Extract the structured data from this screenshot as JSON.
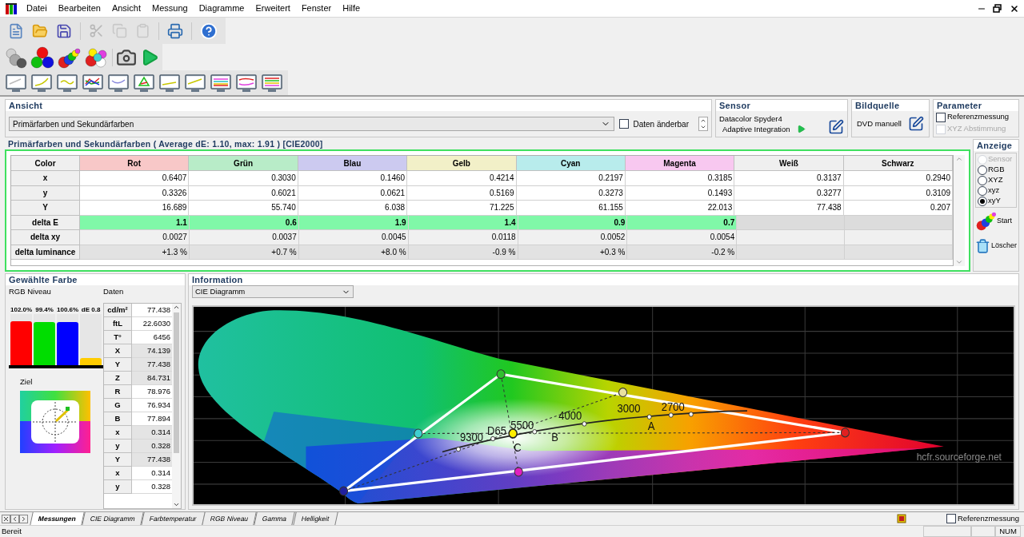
{
  "menu": [
    "Datei",
    "Bearbeiten",
    "Ansicht",
    "Messung",
    "Diagramme",
    "Erweitert",
    "Fenster",
    "Hilfe"
  ],
  "ansicht": {
    "title": "Ansicht",
    "select_value": "Primärfarben und Sekundärfarben",
    "editable": {
      "label": "Daten änderbar",
      "checked": false
    }
  },
  "sensor": {
    "title": "Sensor",
    "device": "Datacolor Spyder4",
    "mode": "Adaptive Integration"
  },
  "bildquelle": {
    "title": "Bildquelle",
    "value": "DVD manuell"
  },
  "parameter": {
    "title": "Parameter",
    "options": [
      {
        "label": "Referenzmessung",
        "checked": false,
        "disabled": false
      },
      {
        "label": "XYZ Abstimmung",
        "checked": false,
        "disabled": true
      }
    ]
  },
  "table": {
    "title": "Primärfarben und Sekundärfarben ( Average dE: 1.10, max: 1.91 ) [CIE2000]",
    "columns": [
      {
        "label": "Color"
      },
      {
        "label": "Rot",
        "color": "#f8c8c8"
      },
      {
        "label": "Grün",
        "color": "#b8ecc8"
      },
      {
        "label": "Blau",
        "color": "#cccaf0"
      },
      {
        "label": "Gelb",
        "color": "#f2f0c8"
      },
      {
        "label": "Cyan",
        "color": "#b8ecec"
      },
      {
        "label": "Magenta",
        "color": "#f8c8f0"
      },
      {
        "label": "Weiß",
        "color": "#efefef"
      },
      {
        "label": "Schwarz",
        "color": "#efefef"
      }
    ],
    "rows": [
      {
        "label": "x",
        "kind": "plain",
        "cells": [
          "0.6407",
          "0.3030",
          "0.1460",
          "0.4214",
          "0.2197",
          "0.3185",
          "0.3137",
          "0.2940"
        ]
      },
      {
        "label": "y",
        "kind": "plain",
        "cells": [
          "0.3326",
          "0.6021",
          "0.0621",
          "0.5169",
          "0.3273",
          "0.1493",
          "0.3277",
          "0.3109"
        ]
      },
      {
        "label": "Y",
        "kind": "plain",
        "cells": [
          "16.689",
          "55.740",
          "6.038",
          "71.225",
          "61.155",
          "22.013",
          "77.438",
          "0.207"
        ]
      },
      {
        "label": "delta E",
        "kind": "rating",
        "cells": [
          "1.1",
          "0.6",
          "1.9",
          "1.4",
          "0.9",
          "0.7"
        ]
      },
      {
        "label": "delta xy",
        "kind": "shaded",
        "cells": [
          "0.0027",
          "0.0037",
          "0.0045",
          "0.0118",
          "0.0052",
          "0.0054"
        ]
      },
      {
        "label": "delta luminance",
        "kind": "dark",
        "cells": [
          "+1.3 %",
          "+0.7 %",
          "+8.0 %",
          "-0.9 %",
          "+0.3 %",
          "-0.2 %"
        ]
      }
    ]
  },
  "anzeige": {
    "title": "Anzeige",
    "options": [
      {
        "label": "Sensor",
        "selected": false,
        "disabled": true
      },
      {
        "label": "RGB",
        "selected": false,
        "disabled": false
      },
      {
        "label": "XYZ",
        "selected": false,
        "disabled": false
      },
      {
        "label": "xyz",
        "selected": false,
        "disabled": false
      },
      {
        "label": "xyY",
        "selected": true,
        "disabled": false
      }
    ],
    "buttons": [
      "Start",
      "Löscher"
    ]
  },
  "gewaehlte_farbe": {
    "title": "Gewählte Farbe",
    "rgb_title": "RGB Niveau",
    "data_title": "Daten",
    "target_label": "Ziel",
    "bars": [
      {
        "label": "102.0%",
        "level": 0.86,
        "color": "#ff0000"
      },
      {
        "label": "99.4%",
        "level": 0.84,
        "color": "#00dd00"
      },
      {
        "label": "100.6%",
        "level": 0.85,
        "color": "#0000ff"
      },
      {
        "label": "dE 0.8",
        "level": 0.14,
        "color": "#ffcc00"
      }
    ],
    "data_rows": [
      {
        "label": "cd/m²",
        "value": "77.438",
        "shaded": false
      },
      {
        "label": "ftL",
        "value": "22.6030",
        "shaded": false
      },
      {
        "label": "T°",
        "value": "6456",
        "shaded": false
      },
      {
        "label": "X",
        "value": "74.139",
        "shaded": true
      },
      {
        "label": "Y",
        "value": "77.438",
        "shaded": true
      },
      {
        "label": "Z",
        "value": "84.731",
        "shaded": true
      },
      {
        "label": "R",
        "value": "78.976",
        "shaded": false
      },
      {
        "label": "G",
        "value": "76.934",
        "shaded": false
      },
      {
        "label": "B",
        "value": "77.894",
        "shaded": false
      },
      {
        "label": "x",
        "value": "0.314",
        "shaded": true
      },
      {
        "label": "y",
        "value": "0.328",
        "shaded": true
      },
      {
        "label": "Y",
        "value": "77.438",
        "shaded": true
      },
      {
        "label": "x",
        "value": "0.314",
        "shaded": false
      },
      {
        "label": "y",
        "value": "0.328",
        "shaded": false
      }
    ]
  },
  "information": {
    "title": "Information",
    "select_value": "CIE Diagramm",
    "labels": [
      "9300",
      "D65",
      "5500",
      "4000",
      "3000",
      "2700",
      "A",
      "B",
      "C"
    ],
    "credit": "hcfr.sourceforge.net"
  },
  "tabs": [
    {
      "label": "Messungen",
      "selected": true
    },
    {
      "label": "CIE Diagramm",
      "selected": false
    },
    {
      "label": "Farbtemperatur",
      "selected": false
    },
    {
      "label": "RGB Niveau",
      "selected": false
    },
    {
      "label": "Gamma",
      "selected": false
    },
    {
      "label": "Helligkeit",
      "selected": false
    }
  ],
  "bottom_option": {
    "label": "Referenzmessung",
    "checked": false
  },
  "status": {
    "text": "Bereit",
    "indicator": "NUM"
  }
}
